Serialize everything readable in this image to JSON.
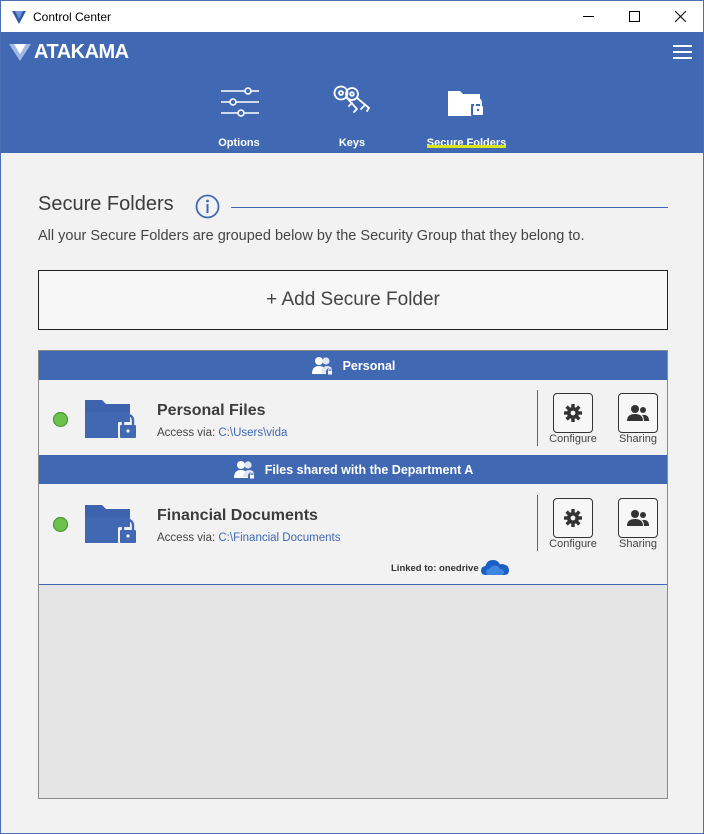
{
  "window": {
    "title": "Control Center",
    "minimize_icon": "minimize-icon",
    "maximize_icon": "maximize-icon",
    "close_icon": "close-icon"
  },
  "header": {
    "brand": "ATAKAMA",
    "menu_icon": "hamburger-menu-icon",
    "accent_color": "#4169b3",
    "active_underline_color": "#d8e31c",
    "tabs": [
      {
        "label": "Options",
        "icon": "sliders-icon",
        "active": false
      },
      {
        "label": "Keys",
        "icon": "keys-icon",
        "active": false
      },
      {
        "label": "Secure Folders",
        "icon": "locked-folder-icon",
        "active": true
      }
    ]
  },
  "page": {
    "title": "Secure Folders",
    "info_icon": "info-icon",
    "subtitle": "All your Secure Folders are grouped below by the Security Group that they belong to.",
    "add_button": "+ Add Secure Folder"
  },
  "groups": [
    {
      "name": "Personal",
      "icon": "group-users-icon",
      "folders": [
        {
          "name": "Personal Files",
          "access_label": "Access via:",
          "path": "C:\\Users\\vida",
          "status_color": "#6cc24a",
          "configure_label": "Configure",
          "sharing_label": "Sharing",
          "linked": null
        }
      ]
    },
    {
      "name": "Files shared with the Department A",
      "icon": "group-users-icon",
      "folders": [
        {
          "name": "Financial Documents",
          "access_label": "Access via:",
          "path": "C:\\Financial Documents",
          "status_color": "#6cc24a",
          "configure_label": "Configure",
          "sharing_label": "Sharing",
          "linked": "Linked to: onedrive"
        }
      ]
    }
  ]
}
